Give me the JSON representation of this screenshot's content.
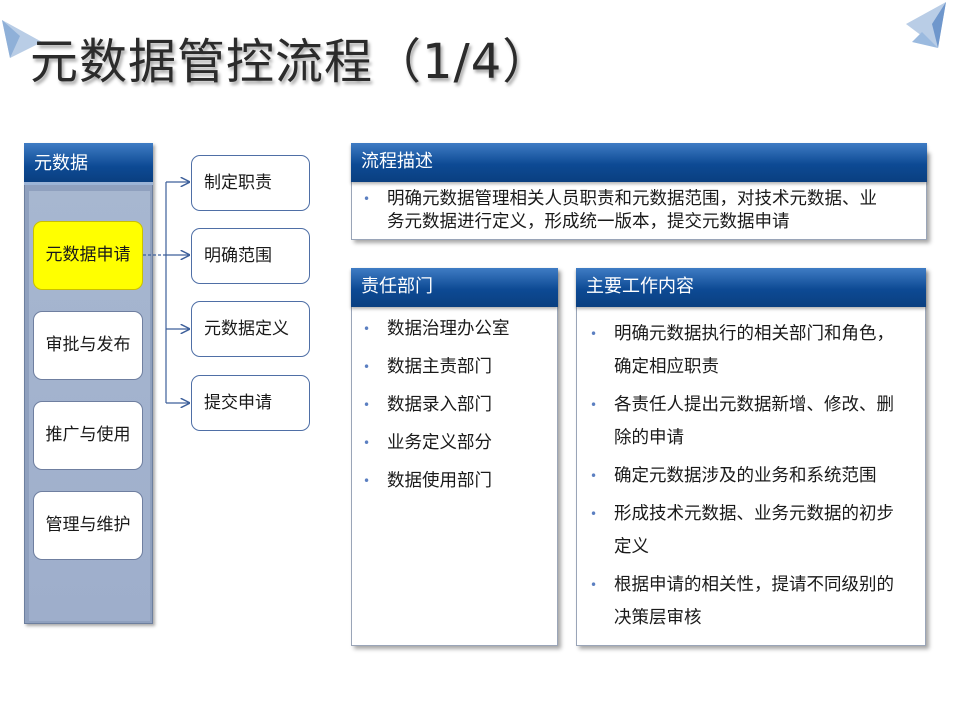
{
  "title": "元数据管控流程（1/4）",
  "colors": {
    "accent": "#0d4a94",
    "highlight": "#ffff00",
    "panel": "#9eaecb",
    "bullet": "#5b7fc1"
  },
  "left_panel": {
    "header": "元数据",
    "steps": [
      "元数据申请",
      "审批与发布",
      "推广与使用",
      "管理与维护"
    ]
  },
  "sub_steps": [
    "制定职责",
    "明确范围",
    "元数据定义",
    "提交申请"
  ],
  "process": {
    "header": "流程描述",
    "line1": "明确元数据管理相关人员职责和元数据范围，对技术元数据、业",
    "line2": "务元数据进行定义，形成统一版本，提交元数据申请"
  },
  "departments": {
    "header": "责任部门",
    "items": [
      "数据治理办公室",
      "数据主责部门",
      "数据录入部门",
      "业务定义部分",
      "数据使用部门"
    ]
  },
  "work": {
    "header": "主要工作内容",
    "items": [
      [
        "明确元数据执行的相关部门和角色，",
        "确定相应职责"
      ],
      [
        "各责任人提出元数据新增、修改、删",
        "除的申请"
      ],
      [
        "确定元数据涉及的业务和系统范围"
      ],
      [
        "形成技术元数据、业务元数据的初步",
        "定义"
      ],
      [
        "根据申请的相关性，提请不同级别的",
        "决策层审核"
      ]
    ]
  },
  "bullet_glyph": "•"
}
